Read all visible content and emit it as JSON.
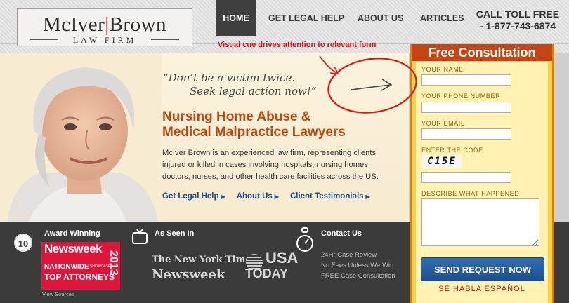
{
  "header": {
    "logo": {
      "name_left": "McIver",
      "separator": "|",
      "name_right": "Brown",
      "tagline": "LAW FIRM"
    },
    "nav": [
      {
        "label": "HOME"
      },
      {
        "label": "GET LEGAL HELP"
      },
      {
        "label": "ABOUT US"
      },
      {
        "label": "ARTICLES"
      }
    ],
    "call": {
      "line1": "CALL TOLL FREE",
      "line2": "- 1-877-743-6874"
    }
  },
  "annotation": {
    "text": "Visual cue drives attention to relevant form",
    "color": "#e41414"
  },
  "hero": {
    "quote_line1": "“Don’t be a victim twice.",
    "quote_line2": "Seek legal action now!”",
    "headline_line1": "Nursing Home Abuse &",
    "headline_line2": "Medical Malpractice Lawyers",
    "description": "McIver Brown is an experienced law firm, representing clients injured or killed in cases involving hospitals, nursing homes, doctors, nurses, and other health care facilities across the US.",
    "links": [
      {
        "label": "Get Legal Help",
        "arrow": "▶"
      },
      {
        "label": "About Us",
        "arrow": "▶"
      },
      {
        "label": "Client Testimonials",
        "arrow": "▶"
      }
    ]
  },
  "footer_band": {
    "award": {
      "badge": "10",
      "title": "Award Winning",
      "newsweek": "Newsweek",
      "nationwide": "NATIONWIDE",
      "showcase": "SHOWCASE",
      "top": "TOP ATTORNEYS",
      "year": "2013",
      "view_sources": "View Sources"
    },
    "seen": {
      "title": "As Seen In",
      "nyt": "The New York Times",
      "newsweek": "Newsweek",
      "usa_line1": "USA",
      "usa_line2": "TODAY"
    },
    "contact": {
      "title": "Contact Us",
      "lines": [
        "24Hr Case Review",
        "No Fees Unless We Win",
        "FREE Case Consultation"
      ]
    }
  },
  "form": {
    "title": "Free Consultation",
    "fields": [
      {
        "label": "YOUR NAME",
        "value": ""
      },
      {
        "label": "YOUR PHONE NUMBER",
        "value": ""
      },
      {
        "label": "YOUR EMAIL",
        "value": ""
      },
      {
        "label": "ENTER THE CODE",
        "value": ""
      },
      {
        "label": "DESCRIBE WHAT HAPPENED",
        "value": ""
      }
    ],
    "captcha": "C15E",
    "submit": "SEND REQUEST NOW",
    "habla": "SE HABLA ESPAÑOL"
  },
  "colors": {
    "accent_orange": "#c0480e",
    "link_blue": "#1d4c8e",
    "form_yellow": "#f9cf4a",
    "form_header": "#c54513",
    "button_blue": "#1c4f8d",
    "dark_band": "#3b3b3b"
  },
  "icons": [
    "tv-icon",
    "stopwatch-icon",
    "award-10-badge-icon",
    "arrow-icon"
  ]
}
